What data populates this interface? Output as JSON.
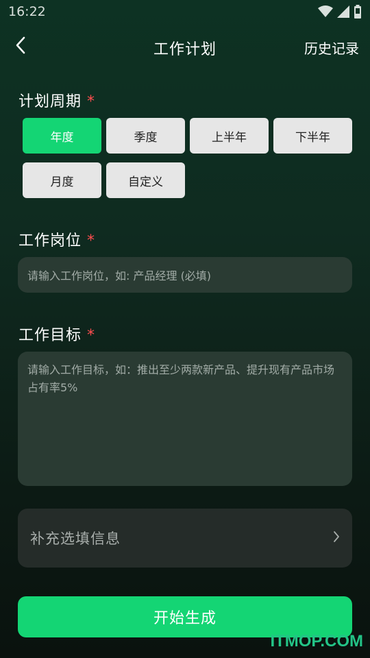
{
  "status_bar": {
    "time": "16:22"
  },
  "nav": {
    "title": "工作计划",
    "history": "历史记录"
  },
  "period": {
    "label": "计划周期",
    "required": "*",
    "options": [
      "年度",
      "季度",
      "上半年",
      "下半年",
      "月度",
      "自定义"
    ],
    "selected": "年度"
  },
  "job": {
    "label": "工作岗位",
    "required": "*",
    "placeholder": "请输入工作岗位，如: 产品经理 (必填)"
  },
  "goal": {
    "label": "工作目标",
    "required": "*",
    "placeholder": "请输入工作目标，如：推出至少两款新产品、提升现有产品市场占有率5%"
  },
  "extra": {
    "label": "补充选填信息"
  },
  "generate": {
    "label": "开始生成"
  },
  "watermark": "ITMOP.COM",
  "colors": {
    "accent": "#14d574",
    "required": "#ff4d4f"
  }
}
